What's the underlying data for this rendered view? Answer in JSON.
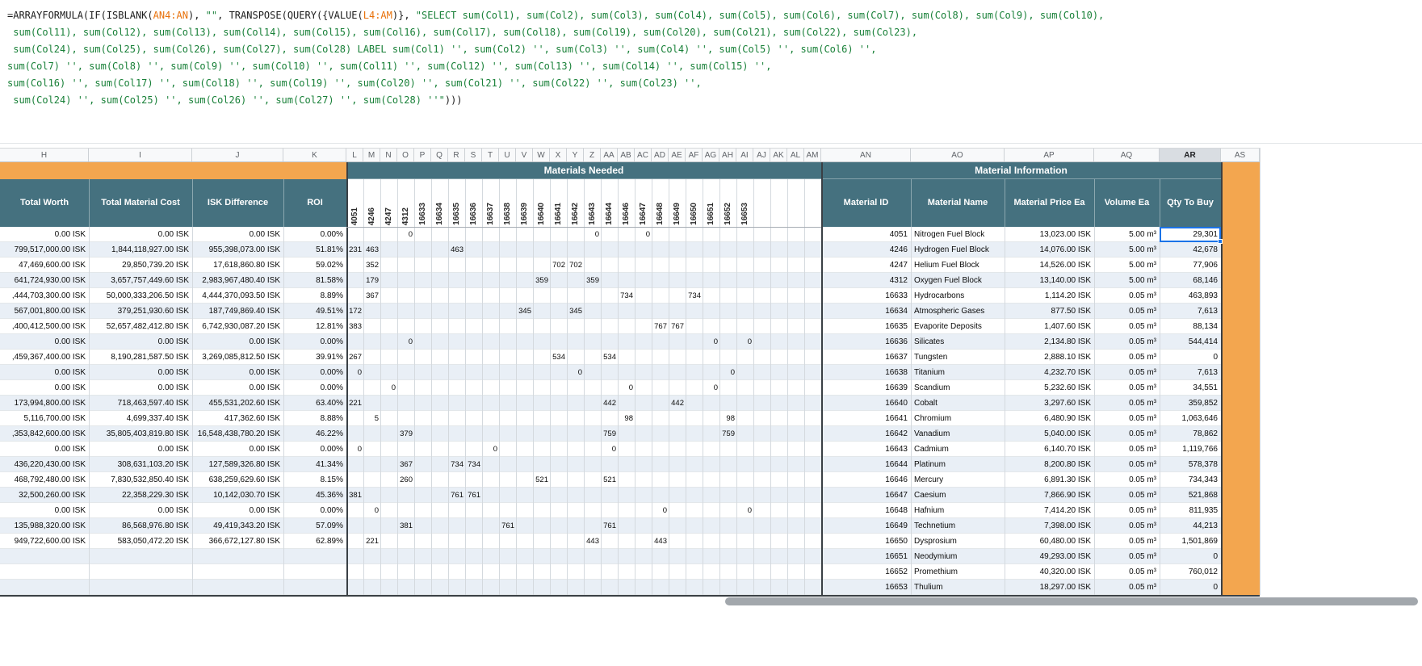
{
  "colors": {
    "plain": "#1c1c1c",
    "string": "#188038",
    "range": "#e8710a",
    "orange": "#f3a64f",
    "teal": "#45717f",
    "stripe": "#e9eff6",
    "selection": "#1a73e8",
    "header_bg": "#f8f9fa",
    "header_text": "#5f6368"
  },
  "formula_bar": {
    "lines": [
      [
        {
          "t": "=ARRAYFORMULA(IF(ISBLANK(",
          "c": "plain"
        },
        {
          "t": "AN4:AN",
          "c": "range"
        },
        {
          "t": "), ",
          "c": "plain"
        },
        {
          "t": "\"\"",
          "c": "string"
        },
        {
          "t": ", TRANSPOSE(QUERY({VALUE(",
          "c": "plain"
        },
        {
          "t": "L4:AM",
          "c": "range"
        },
        {
          "t": ")}, ",
          "c": "plain"
        },
        {
          "t": "\"SELECT sum(Col1), sum(Col2), sum(Col3), sum(Col4), sum(Col5), sum(Col6), sum(Col7), sum(Col8), sum(Col9), sum(Col10),",
          "c": "string"
        }
      ],
      [
        {
          "t": " sum(Col11), sum(Col12), sum(Col13), sum(Col14), sum(Col15), sum(Col16), sum(Col17), sum(Col18), sum(Col19), sum(Col20), sum(Col21), sum(Col22), sum(Col23),",
          "c": "string"
        }
      ],
      [
        {
          "t": " sum(Col24), sum(Col25), sum(Col26), sum(Col27), sum(Col28) LABEL sum(Col1) '', sum(Col2) '', sum(Col3) '', sum(Col4) '', sum(Col5) '', sum(Col6) '',",
          "c": "string"
        }
      ],
      [
        {
          "t": "sum(Col7) '', sum(Col8) '', sum(Col9) '', sum(Col10) '', sum(Col11) '', sum(Col12) '', sum(Col13) '', sum(Col14) '', sum(Col15) '',",
          "c": "string"
        }
      ],
      [
        {
          "t": "sum(Col16) '', sum(Col17) '', sum(Col18) '', sum(Col19) '', sum(Col20) '', sum(Col21) '', sum(Col22) '', sum(Col23) '',",
          "c": "string"
        }
      ],
      [
        {
          "t": " sum(Col24) '', sum(Col25) '', sum(Col26) '', sum(Col27) '', sum(Col28) ''\"",
          "c": "string"
        },
        {
          "t": ")))",
          "c": "plain"
        }
      ]
    ]
  },
  "columns": {
    "letters": [
      "H",
      "I",
      "J",
      "K",
      "L",
      "M",
      "N",
      "O",
      "P",
      "Q",
      "R",
      "S",
      "T",
      "U",
      "V",
      "W",
      "X",
      "Y",
      "Z",
      "AA",
      "AB",
      "AC",
      "AD",
      "AE",
      "AF",
      "AG",
      "AH",
      "AI",
      "AJ",
      "AK",
      "AL",
      "AM",
      "AN",
      "AO",
      "AP",
      "AQ",
      "AR",
      "AS"
    ]
  },
  "band": {
    "materials_needed": "Materials Needed",
    "material_information": "Material Information"
  },
  "selection": {
    "column": "AR",
    "row_index": 0
  },
  "table": {
    "headers": {
      "total_worth": "Total Worth",
      "total_material_cost": "Total Material Cost",
      "isk_difference": "ISK Difference",
      "roi": "ROI",
      "material_id": "Material ID",
      "material_name": "Material Name",
      "material_price": "Material Price Ea",
      "volume": "Volume Ea",
      "qty": "Qty To Buy"
    },
    "matrix_column_ids": [
      "4051",
      "4246",
      "4247",
      "4312",
      "16633",
      "16634",
      "16635",
      "16636",
      "16637",
      "16638",
      "16639",
      "16640",
      "16641",
      "16642",
      "16643",
      "16644",
      "16646",
      "16647",
      "16648",
      "16649",
      "16650",
      "16651",
      "16652",
      "16653"
    ],
    "rows": [
      {
        "h": "0.00 ISK",
        "i": "0.00 ISK",
        "j": "0.00 ISK",
        "k": "0.00%",
        "m": {
          "O": "0",
          "Z": "0",
          "AC": "0"
        },
        "id": "4051",
        "name": "Nitrogen Fuel Block",
        "price": "13,023.00 ISK",
        "vol": "5.00 m³",
        "qty": "29,301"
      },
      {
        "h": "799,517,000.00 ISK",
        "i": "1,844,118,927.00 ISK",
        "j": "955,398,073.00 ISK",
        "k": "51.81%",
        "m": {
          "L": "231",
          "M": "463",
          "R": "463"
        },
        "id": "4246",
        "name": "Hydrogen Fuel Block",
        "price": "14,076.00 ISK",
        "vol": "5.00 m³",
        "qty": "42,678"
      },
      {
        "h": "47,469,600.00 ISK",
        "i": "29,850,739.20 ISK",
        "j": "17,618,860.80 ISK",
        "k": "59.02%",
        "m": {
          "M": "352",
          "X": "702",
          "Y": "702"
        },
        "id": "4247",
        "name": "Helium Fuel Block",
        "price": "14,526.00 ISK",
        "vol": "5.00 m³",
        "qty": "77,906"
      },
      {
        "h": "641,724,930.00 ISK",
        "i": "3,657,757,449.60 ISK",
        "j": "2,983,967,480.40 ISK",
        "k": "81.58%",
        "m": {
          "M": "179",
          "W": "359",
          "Z": "359"
        },
        "id": "4312",
        "name": "Oxygen Fuel Block",
        "price": "13,140.00 ISK",
        "vol": "5.00 m³",
        "qty": "68,146"
      },
      {
        "h": ",444,703,300.00 ISK",
        "i": "50,000,333,206.50 ISK",
        "j": "4,444,370,093.50 ISK",
        "k": "8.89%",
        "m": {
          "M": "367",
          "AB": "734",
          "AF": "734"
        },
        "id": "16633",
        "name": "Hydrocarbons",
        "price": "1,114.20 ISK",
        "vol": "0.05 m³",
        "qty": "463,893"
      },
      {
        "h": "567,001,800.00 ISK",
        "i": "379,251,930.60 ISK",
        "j": "187,749,869.40 ISK",
        "k": "49.51%",
        "m": {
          "L": "172",
          "V": "345",
          "Y": "345"
        },
        "id": "16634",
        "name": "Atmospheric Gases",
        "price": "877.50 ISK",
        "vol": "0.05 m³",
        "qty": "7,613"
      },
      {
        "h": ",400,412,500.00 ISK",
        "i": "52,657,482,412.80 ISK",
        "j": "6,742,930,087.20 ISK",
        "k": "12.81%",
        "m": {
          "L": "383",
          "AD": "767",
          "AE": "767"
        },
        "id": "16635",
        "name": "Evaporite Deposits",
        "price": "1,407.60 ISK",
        "vol": "0.05 m³",
        "qty": "88,134"
      },
      {
        "h": "0.00 ISK",
        "i": "0.00 ISK",
        "j": "0.00 ISK",
        "k": "0.00%",
        "m": {
          "O": "0",
          "AG": "0",
          "AI": "0"
        },
        "id": "16636",
        "name": "Silicates",
        "price": "2,134.80 ISK",
        "vol": "0.05 m³",
        "qty": "544,414"
      },
      {
        "h": ",459,367,400.00 ISK",
        "i": "8,190,281,587.50 ISK",
        "j": "3,269,085,812.50 ISK",
        "k": "39.91%",
        "m": {
          "L": "267",
          "X": "534",
          "AA": "534"
        },
        "id": "16637",
        "name": "Tungsten",
        "price": "2,888.10 ISK",
        "vol": "0.05 m³",
        "qty": "0"
      },
      {
        "h": "0.00 ISK",
        "i": "0.00 ISK",
        "j": "0.00 ISK",
        "k": "0.00%",
        "m": {
          "L": "0",
          "Y": "0",
          "AH": "0"
        },
        "id": "16638",
        "name": "Titanium",
        "price": "4,232.70 ISK",
        "vol": "0.05 m³",
        "qty": "7,613"
      },
      {
        "h": "0.00 ISK",
        "i": "0.00 ISK",
        "j": "0.00 ISK",
        "k": "0.00%",
        "m": {
          "N": "0",
          "AB": "0",
          "AG": "0"
        },
        "id": "16639",
        "name": "Scandium",
        "price": "5,232.60 ISK",
        "vol": "0.05 m³",
        "qty": "34,551"
      },
      {
        "h": "173,994,800.00 ISK",
        "i": "718,463,597.40 ISK",
        "j": "455,531,202.60 ISK",
        "k": "63.40%",
        "m": {
          "L": "221",
          "AA": "442",
          "AE": "442"
        },
        "id": "16640",
        "name": "Cobalt",
        "price": "3,297.60 ISK",
        "vol": "0.05 m³",
        "qty": "359,852"
      },
      {
        "h": "5,116,700.00 ISK",
        "i": "4,699,337.40 ISK",
        "j": "417,362.60 ISK",
        "k": "8.88%",
        "m": {
          "M": "5",
          "AB": "98",
          "AH": "98"
        },
        "id": "16641",
        "name": "Chromium",
        "price": "6,480.90 ISK",
        "vol": "0.05 m³",
        "qty": "1,063,646"
      },
      {
        "h": ",353,842,600.00 ISK",
        "i": "35,805,403,819.80 ISK",
        "j": "16,548,438,780.20 ISK",
        "k": "46.22%",
        "m": {
          "O": "379",
          "AA": "759",
          "AH": "759"
        },
        "id": "16642",
        "name": "Vanadium",
        "price": "5,040.00 ISK",
        "vol": "0.05 m³",
        "qty": "78,862"
      },
      {
        "h": "0.00 ISK",
        "i": "0.00 ISK",
        "j": "0.00 ISK",
        "k": "0.00%",
        "m": {
          "L": "0",
          "T": "0",
          "AA": "0"
        },
        "id": "16643",
        "name": "Cadmium",
        "price": "6,140.70 ISK",
        "vol": "0.05 m³",
        "qty": "1,119,766"
      },
      {
        "h": "436,220,430.00 ISK",
        "i": "308,631,103.20 ISK",
        "j": "127,589,326.80 ISK",
        "k": "41.34%",
        "m": {
          "O": "367",
          "R": "734",
          "S": "734"
        },
        "id": "16644",
        "name": "Platinum",
        "price": "8,200.80 ISK",
        "vol": "0.05 m³",
        "qty": "578,378"
      },
      {
        "h": "468,792,480.00 ISK",
        "i": "7,830,532,850.40 ISK",
        "j": "638,259,629.60 ISK",
        "k": "8.15%",
        "m": {
          "O": "260",
          "W": "521",
          "AA": "521"
        },
        "id": "16646",
        "name": "Mercury",
        "price": "6,891.30 ISK",
        "vol": "0.05 m³",
        "qty": "734,343"
      },
      {
        "h": "32,500,260.00 ISK",
        "i": "22,358,229.30 ISK",
        "j": "10,142,030.70 ISK",
        "k": "45.36%",
        "m": {
          "L": "381",
          "R": "761",
          "S": "761"
        },
        "id": "16647",
        "name": "Caesium",
        "price": "7,866.90 ISK",
        "vol": "0.05 m³",
        "qty": "521,868"
      },
      {
        "h": "0.00 ISK",
        "i": "0.00 ISK",
        "j": "0.00 ISK",
        "k": "0.00%",
        "m": {
          "M": "0",
          "AD": "0",
          "AI": "0"
        },
        "id": "16648",
        "name": "Hafnium",
        "price": "7,414.20 ISK",
        "vol": "0.05 m³",
        "qty": "811,935"
      },
      {
        "h": "135,988,320.00 ISK",
        "i": "86,568,976.80 ISK",
        "j": "49,419,343.20 ISK",
        "k": "57.09%",
        "m": {
          "O": "381",
          "U": "761",
          "AA": "761"
        },
        "id": "16649",
        "name": "Technetium",
        "price": "7,398.00 ISK",
        "vol": "0.05 m³",
        "qty": "44,213"
      },
      {
        "h": "949,722,600.00 ISK",
        "i": "583,050,472.20 ISK",
        "j": "366,672,127.80 ISK",
        "k": "62.89%",
        "m": {
          "M": "221",
          "Z": "443",
          "AD": "443"
        },
        "id": "16650",
        "name": "Dysprosium",
        "price": "60,480.00 ISK",
        "vol": "0.05 m³",
        "qty": "1,501,869"
      },
      {
        "h": "",
        "i": "",
        "j": "",
        "k": "",
        "m": {},
        "id": "16651",
        "name": "Neodymium",
        "price": "49,293.00 ISK",
        "vol": "0.05 m³",
        "qty": "0"
      },
      {
        "h": "",
        "i": "",
        "j": "",
        "k": "",
        "m": {},
        "id": "16652",
        "name": "Promethium",
        "price": "40,320.00 ISK",
        "vol": "0.05 m³",
        "qty": "760,012"
      },
      {
        "h": "",
        "i": "",
        "j": "",
        "k": "",
        "m": {},
        "id": "16653",
        "name": "Thulium",
        "price": "18,297.00 ISK",
        "vol": "0.05 m³",
        "qty": "0"
      }
    ]
  }
}
